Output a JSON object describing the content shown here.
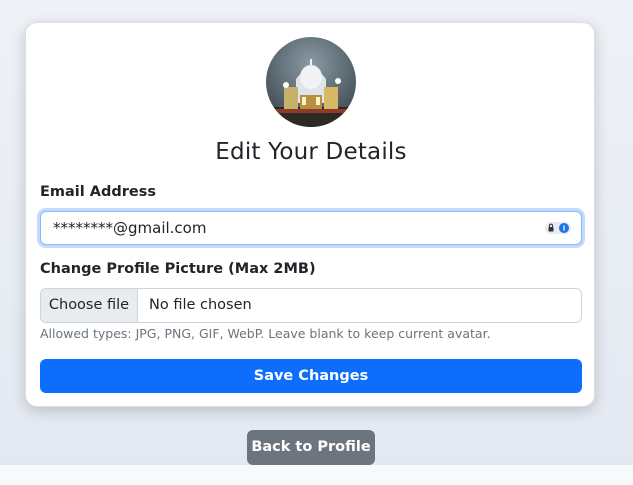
{
  "page": {
    "title": "Edit Your Details"
  },
  "avatar": {
    "alt": "Profile picture"
  },
  "email": {
    "label": "Email Address",
    "value": "********@gmail.com",
    "password_manager_icon": "lock-info-icon"
  },
  "picture": {
    "label": "Change Profile Picture (Max 2MB)",
    "choose_button": "Choose file",
    "no_file_text": "No file chosen",
    "help_text": "Allowed types: JPG, PNG, GIF, WebP. Leave blank to keep current avatar."
  },
  "actions": {
    "save_label": "Save Changes",
    "back_label": "Back to Profile"
  },
  "colors": {
    "primary": "#0d6efd",
    "secondary": "#6c757d",
    "focus_border": "#86b7fe"
  }
}
